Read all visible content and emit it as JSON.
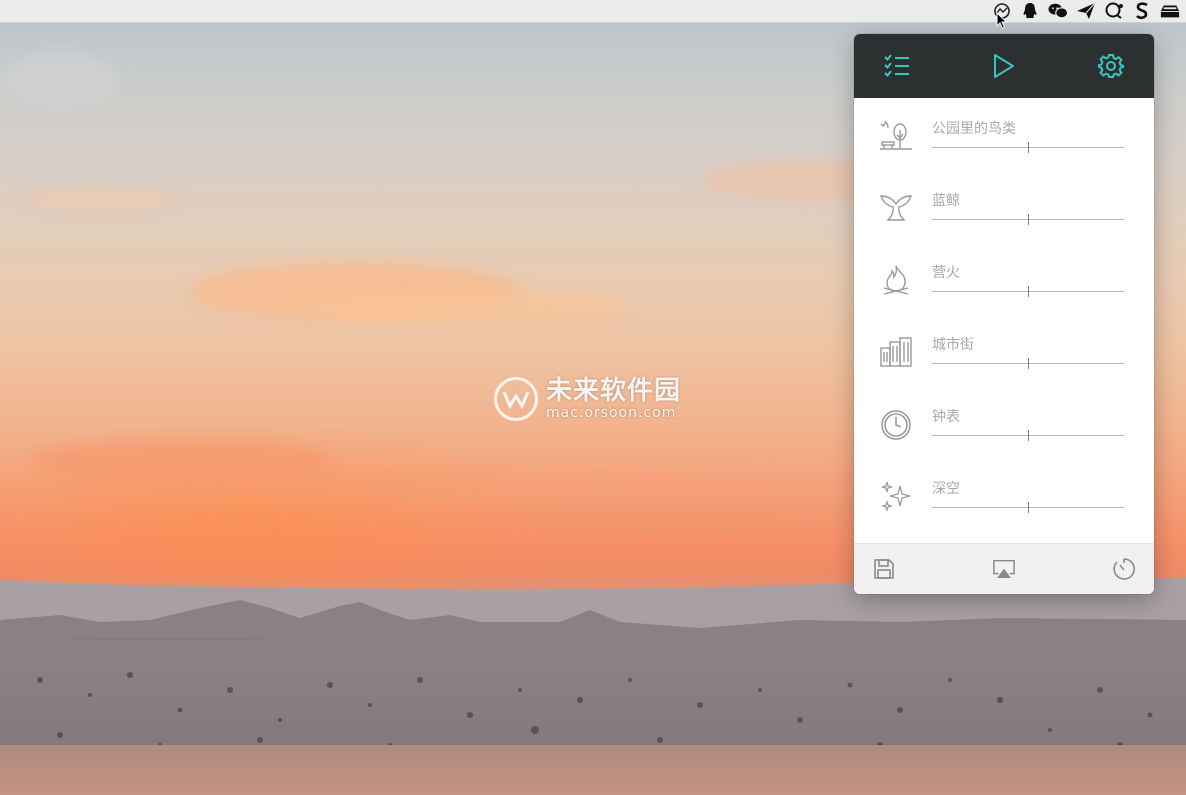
{
  "colors": {
    "accent": "#36c6c0",
    "header_bg": "#2d3031",
    "label": "#a9a9a9",
    "icon": "#9a9a9a"
  },
  "watermark": {
    "title": "未来软件园",
    "url": "mac.orsoon.com"
  },
  "menubar": {
    "icons": [
      "noizio-icon",
      "qq-icon",
      "wechat-icon",
      "send-icon",
      "chat-icon",
      "s-icon",
      "drive-icon"
    ]
  },
  "panel": {
    "header": {
      "list_icon": "checklist-icon",
      "play_icon": "play-icon",
      "settings_icon": "gear-icon"
    },
    "sounds": [
      {
        "label": "公园里的鸟类",
        "icon": "park-birds-icon",
        "volume": 0.5
      },
      {
        "label": "蓝鲸",
        "icon": "whale-tail-icon",
        "volume": 0.5
      },
      {
        "label": "营火",
        "icon": "campfire-icon",
        "volume": 0.5
      },
      {
        "label": "城市街",
        "icon": "city-street-icon",
        "volume": 0.5
      },
      {
        "label": "钟表",
        "icon": "clock-icon",
        "volume": 0.5
      },
      {
        "label": "深空",
        "icon": "deep-space-icon",
        "volume": 0.5
      }
    ],
    "footer": {
      "save_icon": "save-icon",
      "airplay_icon": "airplay-icon",
      "timer_icon": "timer-icon"
    }
  }
}
